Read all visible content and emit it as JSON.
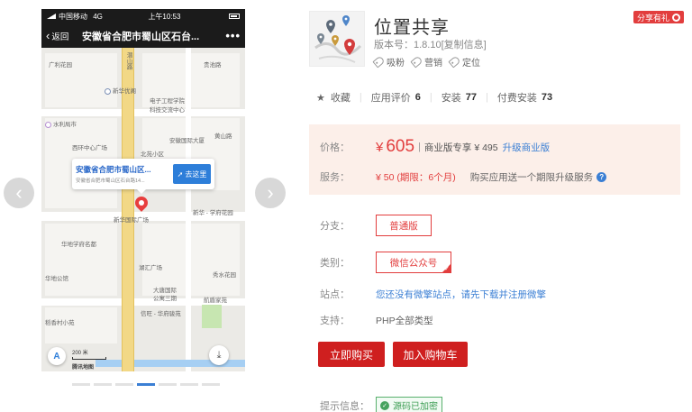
{
  "preview": {
    "status_bar": {
      "carrier": "中国移动",
      "network": "4G",
      "time": "上午10:53"
    },
    "nav": {
      "back_label": "返回",
      "title": "安徽省合肥市蜀山区石台...",
      "more": "•••"
    },
    "map": {
      "labels": [
        "潜山路",
        "广利花园",
        "贵池路",
        "新华优阁",
        "电子工程学院",
        "科技交流中心",
        "水利局市",
        "黄山路",
        "西环中心广场",
        "北苑小区",
        "安徽国际大厦",
        "新华国际广场",
        "新华 - 学府花园",
        "华地学府名都",
        "华地公馆",
        "湖汇广场",
        "大唐国际",
        "公寓三期",
        "秀水花园",
        "稻香村小苑",
        "信旺 - 华府骏苑",
        "航盾家苑"
      ],
      "bubble_title": "安徽省合肥市蜀山区...",
      "bubble_subtitle": "安徽省合肥市蜀山区石台路14...",
      "goto_label": "去这里",
      "scale_label": "200 米",
      "brand": "腾讯地图"
    },
    "dots": {
      "count": 7,
      "active_index": 3
    }
  },
  "app": {
    "name": "位置共享",
    "version_text": "版本号：1.8.10[复制信息]",
    "tags": [
      "吸粉",
      "营销",
      "定位"
    ],
    "share_badge": "分享有礼"
  },
  "stats": {
    "favorite_label": "收藏",
    "rating_label": "应用评价",
    "rating_value": "6",
    "install_label": "安装",
    "install_value": "77",
    "paid_label": "付费安装",
    "paid_value": "73"
  },
  "pricing": {
    "price_label": "价格：",
    "currency": "¥",
    "price": "605",
    "separator": "|",
    "business_text": "商业版专享 ¥ 495",
    "upgrade_link": "升级商业版",
    "service_label": "服务：",
    "service_value": "¥ 50 (期限：6个月)",
    "service_desc": "购买应用送一个期限升级服务",
    "help_icon": "?"
  },
  "options": {
    "branch_label": "分支：",
    "branch_value": "普通版",
    "category_label": "类别：",
    "category_value": "微信公众号",
    "site_label": "站点：",
    "site_text": "您还没有微擎站点，请先下载并注册微擎",
    "support_label": "支持：",
    "support_value": "PHP全部类型"
  },
  "actions": {
    "buy_label": "立即购买",
    "cart_label": "加入购物车"
  },
  "hint": {
    "label": "提示信息：",
    "badge": "源码已加密"
  },
  "colors": {
    "accent_red": "#e23d3d",
    "link_blue": "#3b7fd4",
    "price_bg": "#fcefe9",
    "success_green": "#46a35e"
  }
}
